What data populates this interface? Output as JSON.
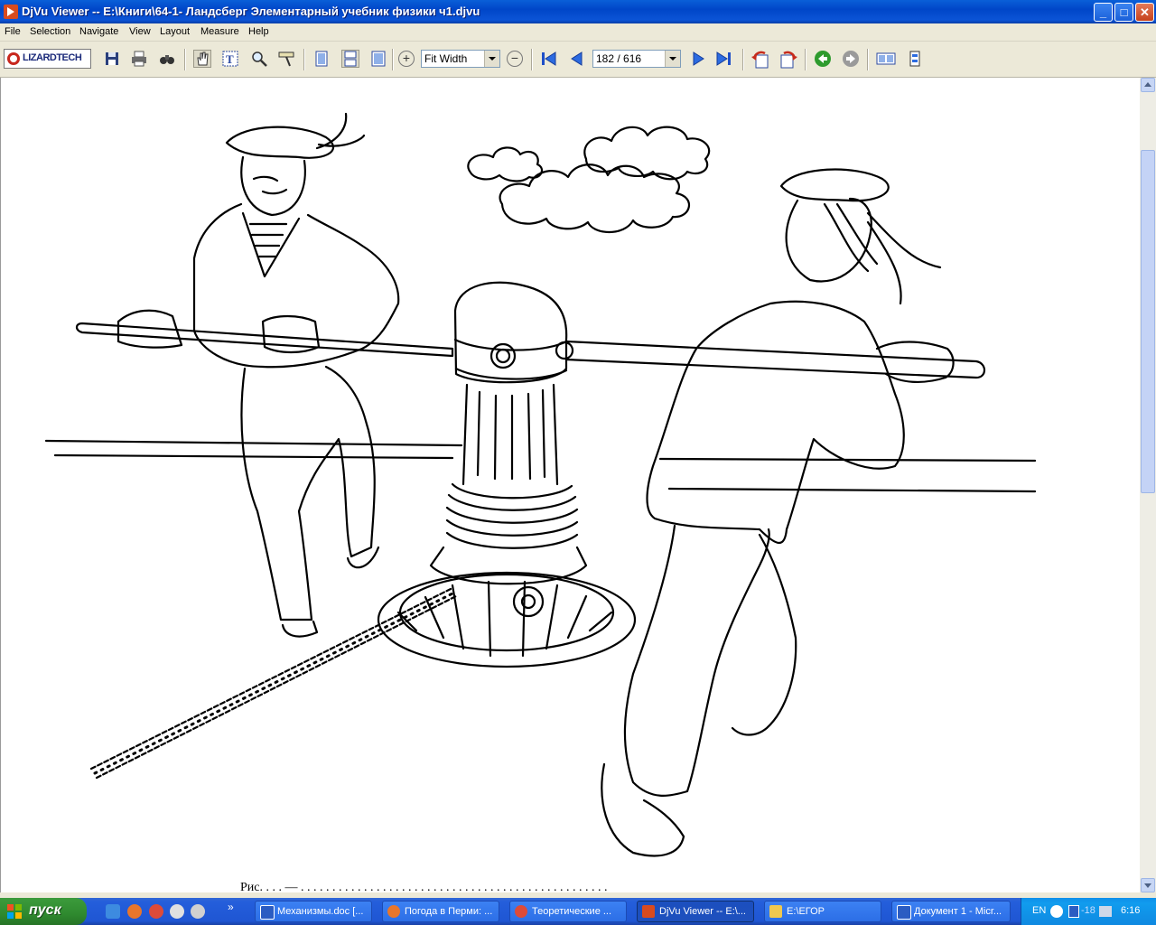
{
  "window": {
    "title": "DjVu Viewer -- E:\\Книги\\64-1- Ландсберг Элементарный учебник физики ч1.djvu",
    "icon": "djvu-app-icon",
    "controls": [
      "minimize",
      "maximize",
      "close"
    ]
  },
  "menu": [
    "File",
    "Selection",
    "Navigate",
    "View",
    "Layout",
    "Measure",
    "Help"
  ],
  "toolbar": {
    "logo": "LIZARDTECH",
    "zoom_value": "Fit Width",
    "page_value": "182 / 616",
    "icons": [
      "save-icon",
      "print-icon",
      "find-icon",
      "pan-hand-icon",
      "text-select-icon",
      "zoom-rect-icon",
      "measure-icon",
      "single-page-icon",
      "continuous-page-icon",
      "facing-pages-icon",
      "zoom-in-icon",
      "zoom-out-icon",
      "first-page-icon",
      "prev-page-icon",
      "next-page-icon",
      "last-page-icon",
      "rotate-left-icon",
      "rotate-right-icon",
      "back-icon",
      "forward-icon",
      "thumbnails-icon",
      "bookmarks-icon"
    ]
  },
  "document": {
    "illustration": "two sailors turning a ship capstan with a rope coiled around it",
    "caption_partial": "Рис. ... — ..."
  },
  "taskbar": {
    "start_label": "пуск",
    "quick_launch": [
      "ie-icon",
      "firefox-icon",
      "chrome-icon",
      "unknown-icon",
      "app-icon"
    ],
    "overflow": "»",
    "tasks": [
      {
        "label": "Механизмы.doc [...",
        "icon": "word-icon",
        "active": false
      },
      {
        "label": "Погода в Перми: ...",
        "icon": "firefox-icon",
        "active": false
      },
      {
        "label": "Теоретические ...",
        "icon": "chrome-icon",
        "active": false
      },
      {
        "label": "DjVu Viewer -- E:\\...",
        "icon": "djvu-icon",
        "active": true
      },
      {
        "label": "E:\\ЕГОР",
        "icon": "folder-icon",
        "active": false
      },
      {
        "label": "Документ 1 - Micr...",
        "icon": "word-icon",
        "active": false
      }
    ],
    "tray": {
      "lang": "EN",
      "temp": "-18",
      "time": "6:16"
    }
  }
}
